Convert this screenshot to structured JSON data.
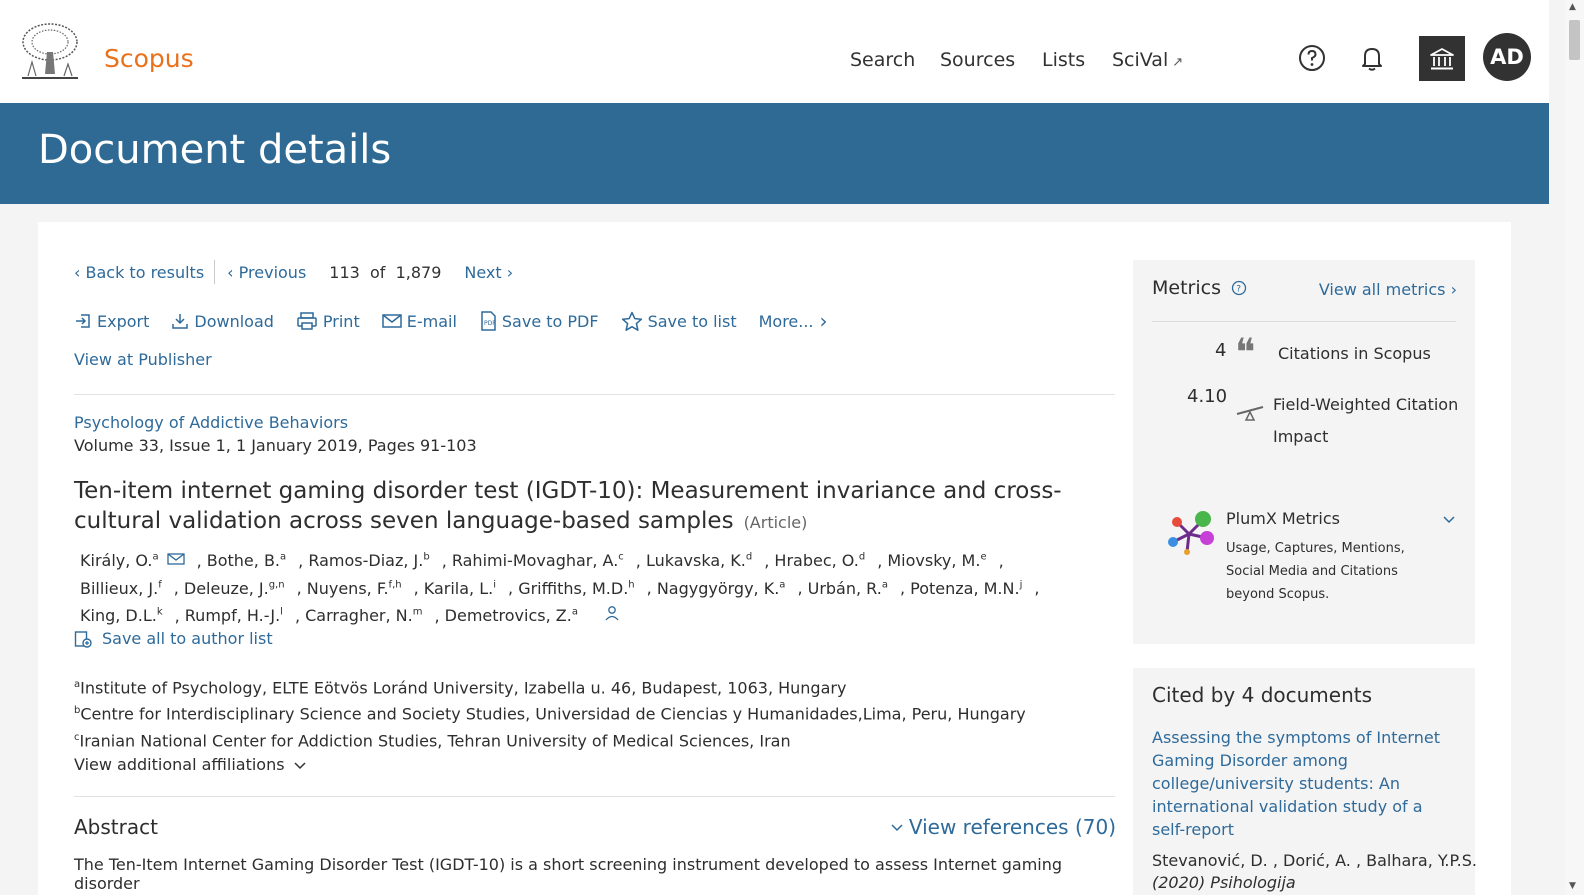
{
  "header": {
    "brand": "Scopus",
    "nav": {
      "search": "Search",
      "sources": "Sources",
      "lists": "Lists",
      "scival": "SciVal",
      "scival_ext": "↗"
    },
    "avatar_initials": "AD"
  },
  "banner": {
    "title": "Document details"
  },
  "result_nav": {
    "back": "Back to results",
    "previous": "Previous",
    "position": "113  of  1,879",
    "next": "Next"
  },
  "toolbar": {
    "export": "Export",
    "download": "Download",
    "print": "Print",
    "email": "E-mail",
    "save_pdf": "Save to PDF",
    "save_list": "Save to list",
    "more": "More..."
  },
  "view_publisher": "View at Publisher",
  "document": {
    "journal": "Psychology of Addictive Behaviors",
    "volume": "Volume 33, Issue 1, 1 January 2019, Pages 91-103",
    "title": "Ten-item internet gaming disorder test (IGDT-10): Measurement invariance and cross-cultural validation across seven language-based samples",
    "doc_type": "(Article)",
    "authors": [
      {
        "name": "Király, O.",
        "sup": "a"
      },
      {
        "name": "Bothe, B.",
        "sup": "a"
      },
      {
        "name": "Ramos-Diaz, J.",
        "sup": "b"
      },
      {
        "name": "Rahimi-Movaghar, A.",
        "sup": "c"
      },
      {
        "name": "Lukavska, K.",
        "sup": "d"
      },
      {
        "name": "Hrabec, O.",
        "sup": "d"
      },
      {
        "name": "Miovsky, M.",
        "sup": "e"
      },
      {
        "name": "Billieux, J.",
        "sup": "f"
      },
      {
        "name": "Deleuze, J.",
        "sup": "g,n"
      },
      {
        "name": "Nuyens, F.",
        "sup": "f,h"
      },
      {
        "name": "Karila, L.",
        "sup": "i"
      },
      {
        "name": "Griffiths, M.D.",
        "sup": "h"
      },
      {
        "name": "Nagygyörgy, K.",
        "sup": "a"
      },
      {
        "name": "Urbán, R.",
        "sup": "a"
      },
      {
        "name": "Potenza, M.N.",
        "sup": "j"
      },
      {
        "name": "King, D.L.",
        "sup": "k"
      },
      {
        "name": "Rumpf, H.-J.",
        "sup": "l"
      },
      {
        "name": "Carragher, N.",
        "sup": "m"
      },
      {
        "name": "Demetrovics, Z.",
        "sup": "a"
      }
    ],
    "save_authors": "Save all to author list",
    "affiliations": [
      {
        "sup": "a",
        "text": "Institute of Psychology, ELTE Eötvös Loránd University, Izabella u. 46, Budapest, 1063, Hungary"
      },
      {
        "sup": "b",
        "text": "Centre for Interdisciplinary Science and Society Studies, Universidad de Ciencias y Humanidades,Lima, Peru, Hungary"
      },
      {
        "sup": "c",
        "text": "Iranian National Center for Addiction Studies, Tehran University of Medical Sciences, Iran"
      }
    ],
    "view_more_affiliations": "View additional affiliations",
    "abstract_heading": "Abstract",
    "view_references": "View references (70)",
    "abstract_text": "The Ten-Item Internet Gaming Disorder Test (IGDT-10) is a short screening instrument developed to assess Internet gaming disorder"
  },
  "metrics": {
    "heading": "Metrics",
    "view_all": "View all metrics",
    "citations_count": "4",
    "citations_label": "Citations in Scopus",
    "fwci_value": "4.10",
    "fwci_label": "Field-Weighted Citation Impact",
    "plumx_title": "PlumX Metrics",
    "plumx_desc": "Usage, Captures, Mentions, Social Media and Citations beyond Scopus."
  },
  "cited_by": {
    "heading": "Cited by 4 documents",
    "doc_title": "Assessing the symptoms of Internet Gaming Disorder among college/university students: An international validation study of a self-report",
    "doc_authors": "Stevanović, D. , Dorić, A. , Balhara, Y.P.S.",
    "doc_source": "(2020) Psihologija"
  },
  "colors": {
    "brand_orange": "#e9711c",
    "banner_blue": "#2e6a94",
    "link_blue": "#2e6a9a",
    "dark": "#323232"
  }
}
